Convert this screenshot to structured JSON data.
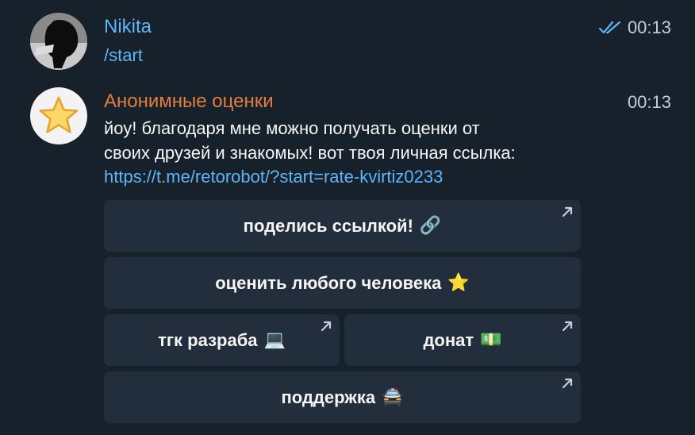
{
  "messages": [
    {
      "sender": "Nikita",
      "time": "00:13",
      "status": "double-check-read",
      "text": "/start"
    },
    {
      "sender": "Анонимные оценки",
      "time": "00:13",
      "avatar_icon": "star-icon",
      "text_lines": [
        "йоу! благодаря мне можно получать оценки от",
        "своих друзей и знакомых! вот твоя личная ссылка:"
      ],
      "link": "https://t.me/retorobot/?start=rate-kvirtiz0233"
    }
  ],
  "keyboard": {
    "share": {
      "label": "поделись ссылкой!",
      "emoji": "🔗",
      "icon": "link-icon"
    },
    "rate": {
      "label": "оценить любого человека",
      "emoji": "⭐",
      "icon": "star-icon"
    },
    "dev": {
      "label": "тгк разраба",
      "emoji": "💻",
      "icon": "laptop-icon"
    },
    "donate": {
      "label": "донат",
      "emoji": "💵",
      "icon": "banknote-icon"
    },
    "support": {
      "label": "поддержка",
      "emoji": "🚔",
      "icon": "police-car-icon"
    }
  },
  "colors": {
    "background": "#17212b",
    "button_bg": "#232e3c",
    "user_name": "#5eb5f7",
    "bot_name": "#e07e3f",
    "link": "#5eb5f7",
    "time": "#c6cfd8"
  }
}
